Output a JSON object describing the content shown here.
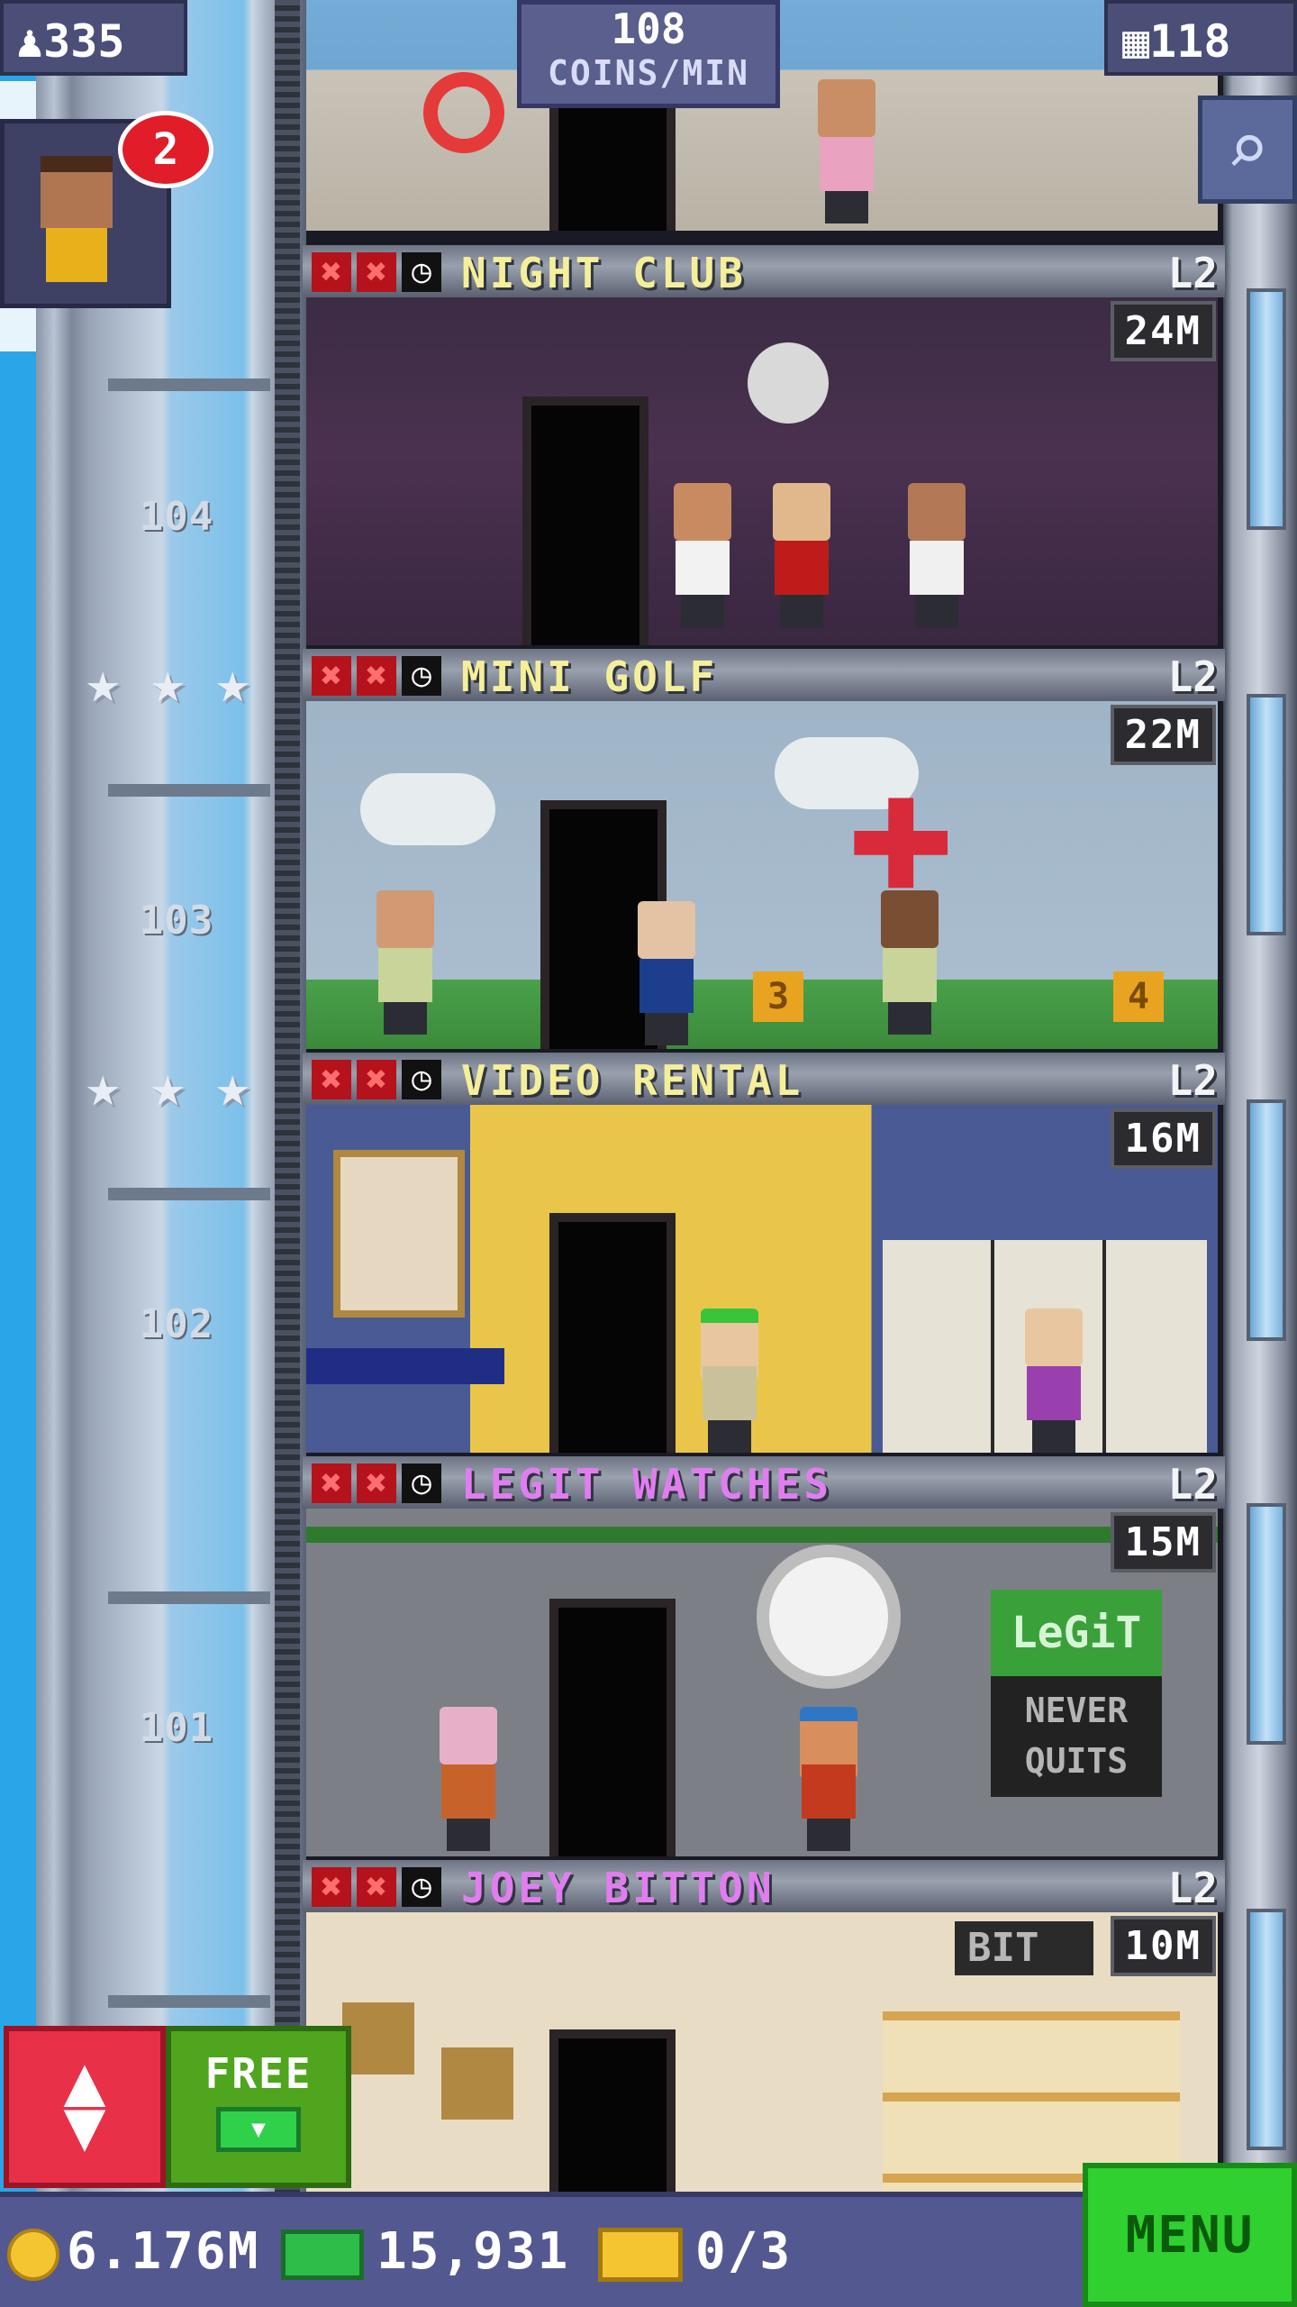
{
  "hud": {
    "population": "335",
    "coins_per_min_value": "108",
    "coins_per_min_unit": "COINS/MIN",
    "floor_count": "118",
    "population_icon": "person-icon",
    "floors_icon": "building-icon",
    "search_icon": "magnifier-icon"
  },
  "visitor": {
    "badge_count": "2",
    "icon": "visitor-avatar"
  },
  "floor_numbers": [
    "104",
    "103",
    "102",
    "101"
  ],
  "floors": [
    {
      "name": "NIGHT CLUB",
      "level": "L2",
      "stock": "24M",
      "name_color": "#f5ef9a"
    },
    {
      "name": "MINI GOLF",
      "level": "L2",
      "stock": "22M",
      "name_color": "#f5ef9a"
    },
    {
      "name": "VIDEO RENTAL",
      "level": "L2",
      "stock": "16M",
      "name_color": "#f5ef9a"
    },
    {
      "name": "LEGIT WATCHES",
      "level": "L2",
      "stock": "15M",
      "name_color": "#e07ef0"
    },
    {
      "name": "JOEY BITTON",
      "level": "L2",
      "stock": "10M",
      "name_color": "#e07ef0"
    }
  ],
  "room_signs": {
    "golf_hole_left": "3",
    "golf_hole_right": "4",
    "legit_logo": "LeGiT",
    "legit_slogan_1": "NEVER",
    "legit_slogan_2": "QUITS",
    "bitton_sign": "BIT"
  },
  "buttons": {
    "elevator_icon": "up-down-arrows-icon",
    "free_label": "FREE",
    "menu_label": "MENU"
  },
  "bottom": {
    "coins": "6.176M",
    "bux": "15,931",
    "tickets": "0/3"
  },
  "colors": {
    "stock_name_yellow": "#f5ef9a",
    "stock_name_pink": "#e07ef0",
    "menu_green": "#2fd02f",
    "elevator_red": "#e83048"
  }
}
